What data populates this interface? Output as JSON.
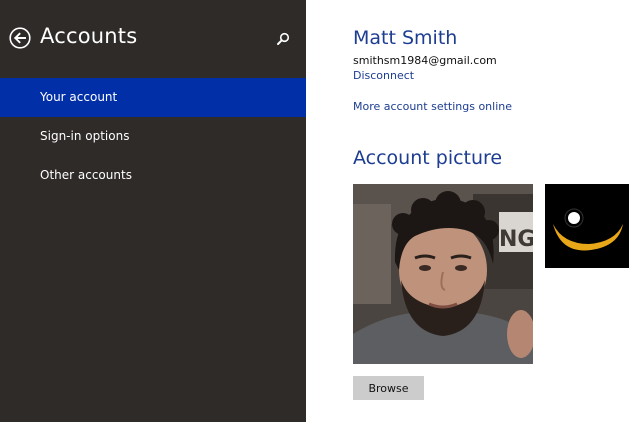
{
  "colors": {
    "left_panel_bg": "#2e2b29",
    "selected_item_bg": "#002fa7",
    "accent_text": "#1c3d91",
    "button_bg": "#cccccc"
  },
  "sidebar": {
    "title": "Accounts",
    "back_icon": "back-arrow-icon",
    "search_icon": "search-icon",
    "items": [
      {
        "label": "Your account",
        "selected": true
      },
      {
        "label": "Sign-in options",
        "selected": false
      },
      {
        "label": "Other accounts",
        "selected": false
      }
    ]
  },
  "account": {
    "name": "Matt Smith",
    "email": "smithsm1984@gmail.com",
    "disconnect_label": "Disconnect",
    "more_settings_label": "More account settings online"
  },
  "picture_section": {
    "heading": "Account picture",
    "main_picture": "user-photo",
    "alt_picture": "eye-logo-picture",
    "browse_label": "Browse"
  }
}
